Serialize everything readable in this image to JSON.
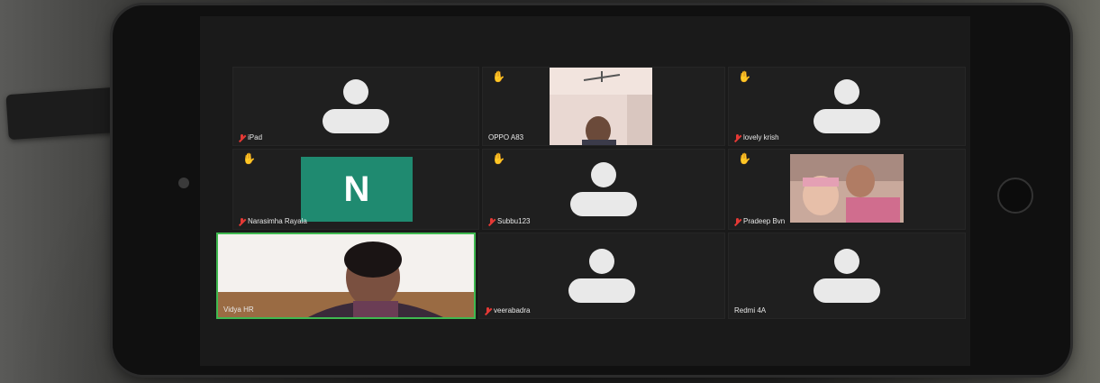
{
  "tiles": [
    {
      "name": "iPad",
      "muted": true,
      "hand": false,
      "type": "avatar"
    },
    {
      "name": "OPPO A83",
      "muted": false,
      "hand": true,
      "type": "video"
    },
    {
      "name": "lovely krish",
      "muted": true,
      "hand": true,
      "type": "avatar"
    },
    {
      "name": "Narasimha Rayala",
      "muted": true,
      "hand": true,
      "type": "letter",
      "initial": "N"
    },
    {
      "name": "Subbu123",
      "muted": true,
      "hand": true,
      "type": "avatar"
    },
    {
      "name": "Pradeep Bvn",
      "muted": true,
      "hand": true,
      "type": "video"
    },
    {
      "name": "Vidya HR",
      "muted": false,
      "hand": false,
      "type": "video",
      "active": true
    },
    {
      "name": "veerabadra",
      "muted": true,
      "hand": false,
      "type": "avatar"
    },
    {
      "name": "Redmi 4A",
      "muted": false,
      "hand": false,
      "type": "avatar"
    }
  ],
  "icons": {
    "hand": "raised-hand-icon",
    "mute": "mic-muted-icon",
    "avatar": "person-placeholder-icon"
  },
  "colors": {
    "tile_bg": "#1f1f1f",
    "active_border": "#3fb950",
    "mute_red": "#e53935",
    "hand_yellow": "#f5c518",
    "letter_avatar": "#1f8a70"
  }
}
